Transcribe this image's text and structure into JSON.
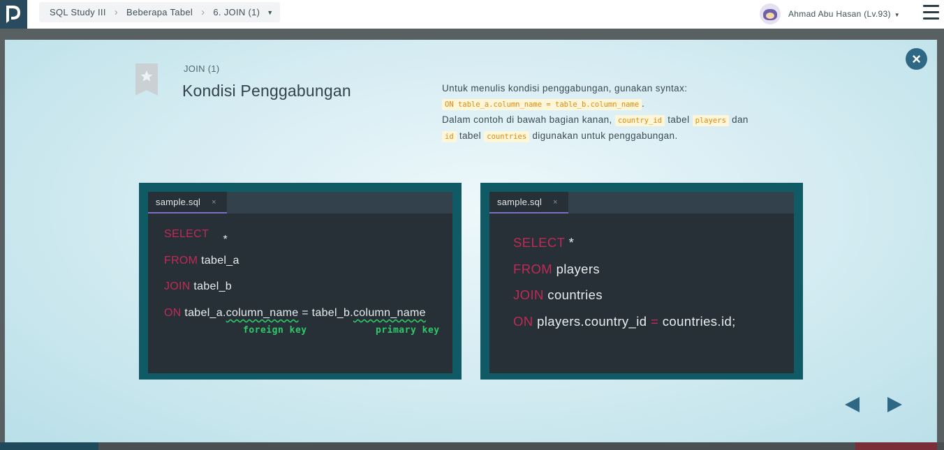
{
  "breadcrumb": {
    "course": "SQL Study III",
    "section": "Beberapa Tabel",
    "lesson": "6. JOIN (1)"
  },
  "user": {
    "name": "Ahmad Abu Hasan (Lv.93)"
  },
  "slide": {
    "label": "JOIN (1)",
    "title": "Kondisi Penggabungan",
    "desc": {
      "line1": "Untuk menulis kondisi penggabungan, gunakan syntax:",
      "syntax": "ON table_a.column_name = table_b.column_name",
      "syntax_end": ".",
      "line3_a": "Dalam contoh di bawah bagian kanan,",
      "code_country_id": "country_id",
      "line3_b": "tabel",
      "code_players": "players",
      "line3_c": "dan",
      "code_id": "id",
      "line4_a": "tabel",
      "code_countries": "countries",
      "line4_b": "digunakan untuk penggabungan."
    }
  },
  "editor_left": {
    "tab": "sample.sql",
    "tab_close": "×",
    "l1_kw": "SELECT",
    "l1_rest": "*",
    "l2_kw": "FROM",
    "l2_rest": "tabel_a",
    "l3_kw": "JOIN",
    "l3_rest": "tabel_b",
    "l4_kw": "ON",
    "l4_a": "tabel_a.",
    "l4_b": "column_name",
    "l4_c": " = tabel_b.",
    "l4_d": "column_name",
    "annot_fk": "foreign key",
    "annot_pk": "primary key"
  },
  "editor_right": {
    "tab": "sample.sql",
    "tab_close": "×",
    "l1_kw": "SELECT",
    "l1_rest": "*",
    "l2_kw": "FROM",
    "l2_rest": "players",
    "l3_kw": "JOIN",
    "l3_rest": "countries",
    "l4_kw": "ON",
    "l4_a": "players.country_id",
    "l4_eq": "=",
    "l4_b": "countries.id;"
  },
  "colors": {
    "keyword": "#c22a56",
    "annotation": "#2fc96a",
    "accent": "#2e6884"
  }
}
